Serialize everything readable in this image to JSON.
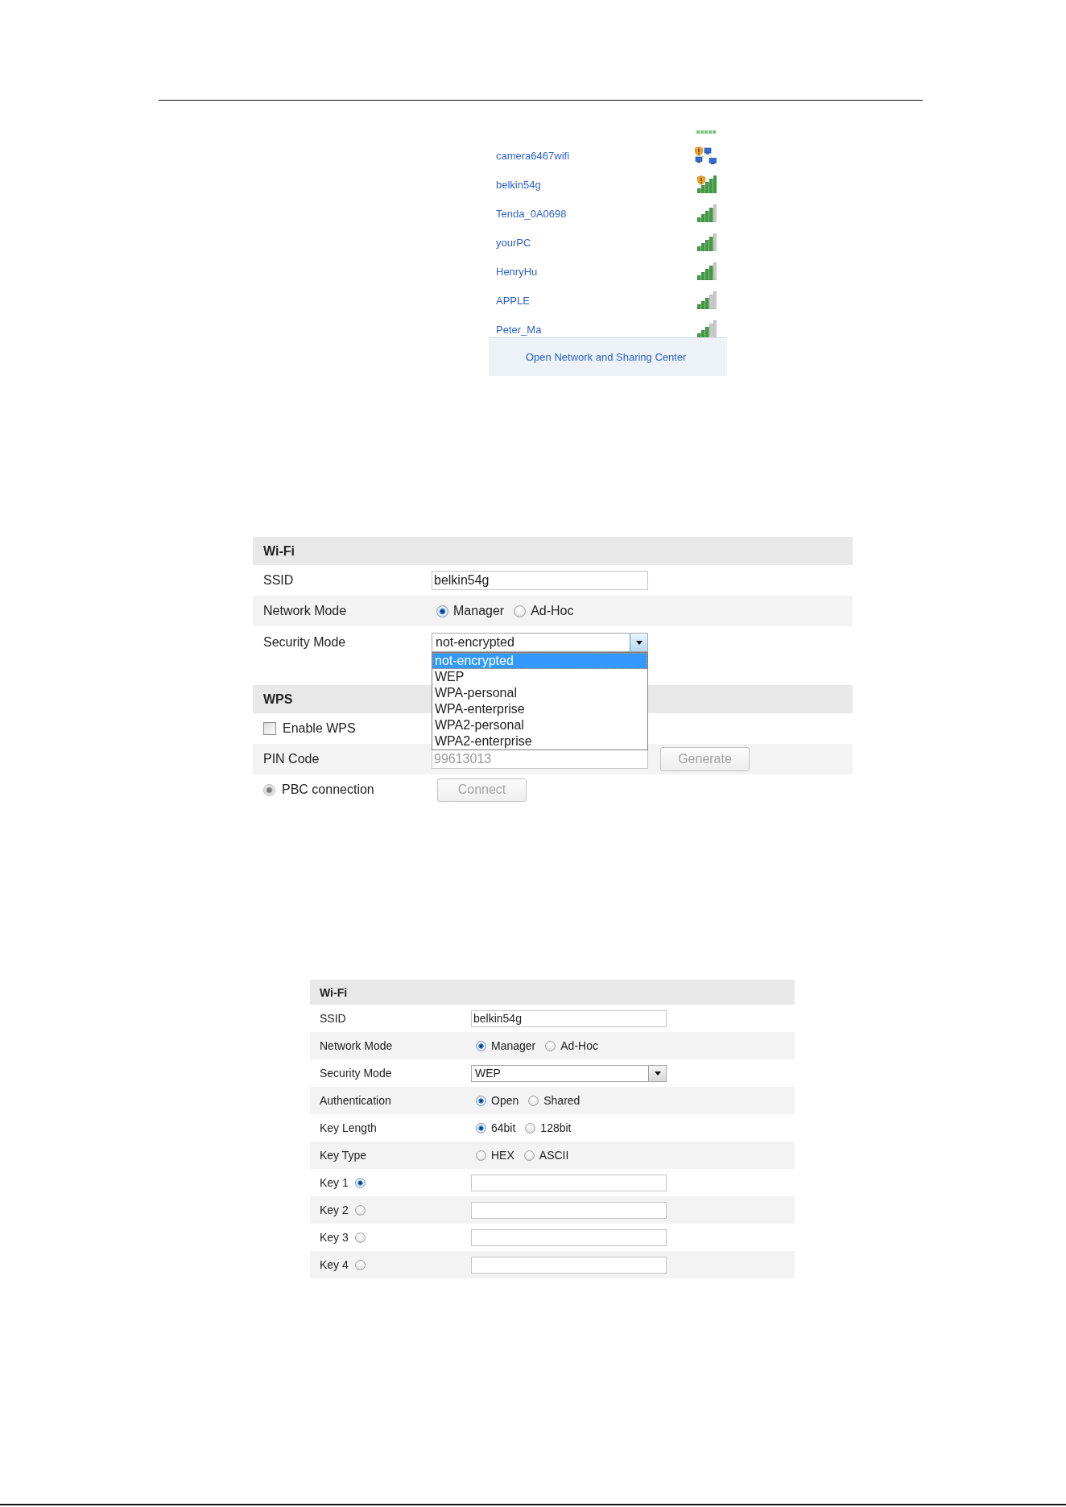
{
  "network_list": {
    "networks": [
      {
        "name": "camera6467wifi",
        "kind": "adhoc"
      },
      {
        "name": "belkin54g",
        "kind": "unsecured"
      },
      {
        "name": "Tenda_0A0698",
        "kind": "strong"
      },
      {
        "name": "yourPC",
        "kind": "strong"
      },
      {
        "name": "HenryHu",
        "kind": "strong"
      },
      {
        "name": "APPLE",
        "kind": "fair"
      },
      {
        "name": "Peter_Ma",
        "kind": "fair"
      }
    ],
    "footer_link": "Open Network and Sharing Center"
  },
  "forms": [
    {
      "rows": [
        {
          "kind": "header",
          "label": "Wi-Fi"
        },
        {
          "kind": "text",
          "label": "SSID",
          "value": "belkin54g",
          "disabled": false
        },
        {
          "kind": "radio",
          "label": "Network Mode",
          "options": [
            {
              "label": "Manager",
              "selected": true
            },
            {
              "label": "Ad-Hoc",
              "selected": false
            }
          ]
        },
        {
          "kind": "select",
          "label": "Security Mode",
          "value": "not-encrypted",
          "expanded": true,
          "options": [
            {
              "label": "not-encrypted",
              "selected": true
            },
            {
              "label": "WEP",
              "selected": false
            },
            {
              "label": "WPA-personal",
              "selected": false
            },
            {
              "label": "WPA-enterprise",
              "selected": false
            },
            {
              "label": "WPA2-personal",
              "selected": false
            },
            {
              "label": "WPA2-enterprise",
              "selected": false
            }
          ]
        },
        {
          "kind": "header",
          "label": "WPS"
        },
        {
          "kind": "checkbox",
          "label": "Enable WPS",
          "checked": false
        },
        {
          "kind": "text",
          "label": "PIN Code",
          "value": "99613013",
          "disabled": true,
          "button": {
            "label": "Generate",
            "disabled": true
          }
        },
        {
          "kind": "option",
          "label": "PBC connection",
          "selected": true,
          "disabled": true,
          "button": {
            "label": "Connect",
            "disabled": true
          }
        }
      ]
    },
    {
      "rows": [
        {
          "kind": "header",
          "label": "Wi-Fi"
        },
        {
          "kind": "text",
          "label": "SSID",
          "value": "belkin54g",
          "disabled": false
        },
        {
          "kind": "radio",
          "label": "Network Mode",
          "options": [
            {
              "label": "Manager",
              "selected": true
            },
            {
              "label": "Ad-Hoc",
              "selected": false
            }
          ]
        },
        {
          "kind": "select",
          "label": "Security Mode",
          "value": "WEP",
          "expanded": false
        },
        {
          "kind": "radio",
          "label": "Authentication",
          "options": [
            {
              "label": "Open",
              "selected": true
            },
            {
              "label": "Shared",
              "selected": false
            }
          ]
        },
        {
          "kind": "radio",
          "label": "Key Length",
          "options": [
            {
              "label": "64bit",
              "selected": true
            },
            {
              "label": "128bit",
              "selected": false
            }
          ]
        },
        {
          "kind": "radio",
          "label": "Key Type",
          "options": [
            {
              "label": "HEX",
              "selected": false
            },
            {
              "label": "ASCII",
              "selected": false
            }
          ]
        },
        {
          "kind": "key",
          "label": "Key 1",
          "selected": true
        },
        {
          "kind": "key",
          "label": "Key 2",
          "selected": false
        },
        {
          "kind": "key",
          "label": "Key 3",
          "selected": false
        },
        {
          "kind": "key",
          "label": "Key 4",
          "selected": false
        }
      ]
    }
  ]
}
